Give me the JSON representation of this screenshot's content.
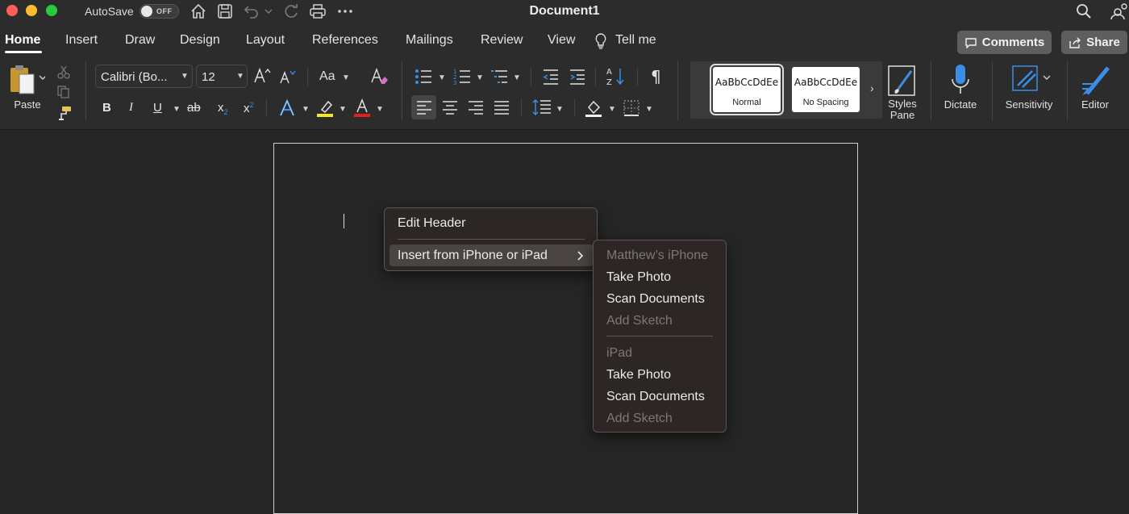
{
  "titlebar": {
    "autosave_label": "AutoSave",
    "autosave_state": "OFF",
    "document_title": "Document1"
  },
  "tabs": [
    {
      "label": "Home",
      "active": true
    },
    {
      "label": "Insert"
    },
    {
      "label": "Draw"
    },
    {
      "label": "Design"
    },
    {
      "label": "Layout"
    },
    {
      "label": "References"
    },
    {
      "label": "Mailings"
    },
    {
      "label": "Review"
    },
    {
      "label": "View"
    },
    {
      "label": "Tell me"
    }
  ],
  "header_buttons": {
    "comments_label": "Comments",
    "share_label": "Share"
  },
  "ribbon": {
    "paste_label": "Paste",
    "font_name": "Calibri (Bo...",
    "font_size": "12",
    "change_case_label": "Aa",
    "bold": "B",
    "italic": "I",
    "underline": "U",
    "strike": "ab",
    "subscript": "x",
    "superscript": "x",
    "styles": [
      {
        "sample": "AaBbCcDdEe",
        "name": "Normal",
        "selected": true
      },
      {
        "sample": "AaBbCcDdEe",
        "name": "No Spacing"
      }
    ],
    "styles_pane_label_1": "Styles",
    "styles_pane_label_2": "Pane",
    "dictate_label": "Dictate",
    "sensitivity_label": "Sensitivity",
    "editor_label": "Editor",
    "highlight_color": "#f5e81c",
    "font_color": "#e02020",
    "accent_blue": "#3a8ee6"
  },
  "context_menu": {
    "items": [
      {
        "label": "Edit Header"
      },
      {
        "label": "Insert from iPhone or iPad",
        "has_submenu": true,
        "highlighted": true
      }
    ]
  },
  "submenu": {
    "groups": [
      {
        "device": "Matthew’s iPhone",
        "items": [
          {
            "label": "Take Photo",
            "enabled": true
          },
          {
            "label": "Scan Documents",
            "enabled": true
          },
          {
            "label": "Add Sketch",
            "enabled": false
          }
        ]
      },
      {
        "device": "iPad",
        "items": [
          {
            "label": "Take Photo",
            "enabled": true
          },
          {
            "label": "Scan Documents",
            "enabled": true
          },
          {
            "label": "Add Sketch",
            "enabled": false
          }
        ]
      }
    ]
  }
}
